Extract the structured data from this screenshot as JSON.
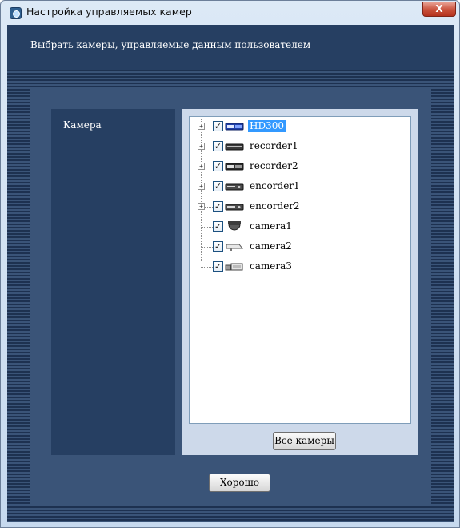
{
  "window": {
    "title": "Настройка управляемых камер",
    "close_label": "X"
  },
  "header": {
    "text": "Выбрать камеры, управляемые данным пользователем"
  },
  "panel": {
    "camera_label": "Камера"
  },
  "tree": {
    "nodes": [
      {
        "label": "HD300",
        "icon": "recorder-hd-icon",
        "checked": "✓",
        "expander": "+",
        "selected": true
      },
      {
        "label": "recorder1",
        "icon": "recorder-icon",
        "checked": "✓",
        "expander": "+",
        "selected": false
      },
      {
        "label": "recorder2",
        "icon": "recorder-icon",
        "checked": "✓",
        "expander": "+",
        "selected": false
      },
      {
        "label": "encorder1",
        "icon": "encoder-icon",
        "checked": "✓",
        "expander": "+",
        "selected": false
      },
      {
        "label": "encorder2",
        "icon": "encoder-icon",
        "checked": "✓",
        "expander": "+",
        "selected": false
      },
      {
        "label": "camera1",
        "icon": "dome-camera-icon",
        "checked": "✓",
        "selected": false
      },
      {
        "label": "camera2",
        "icon": "box-camera-icon",
        "checked": "✓",
        "selected": false
      },
      {
        "label": "camera3",
        "icon": "camera-group-icon",
        "checked": "✓",
        "selected": false
      }
    ]
  },
  "buttons": {
    "all_cameras": "Все камеры",
    "ok": "Хорошо"
  },
  "colors": {
    "client_bg": "#22385a",
    "panel_bg": "#3a5478",
    "label_column_bg": "#263f62",
    "selection": "#3399ff"
  }
}
